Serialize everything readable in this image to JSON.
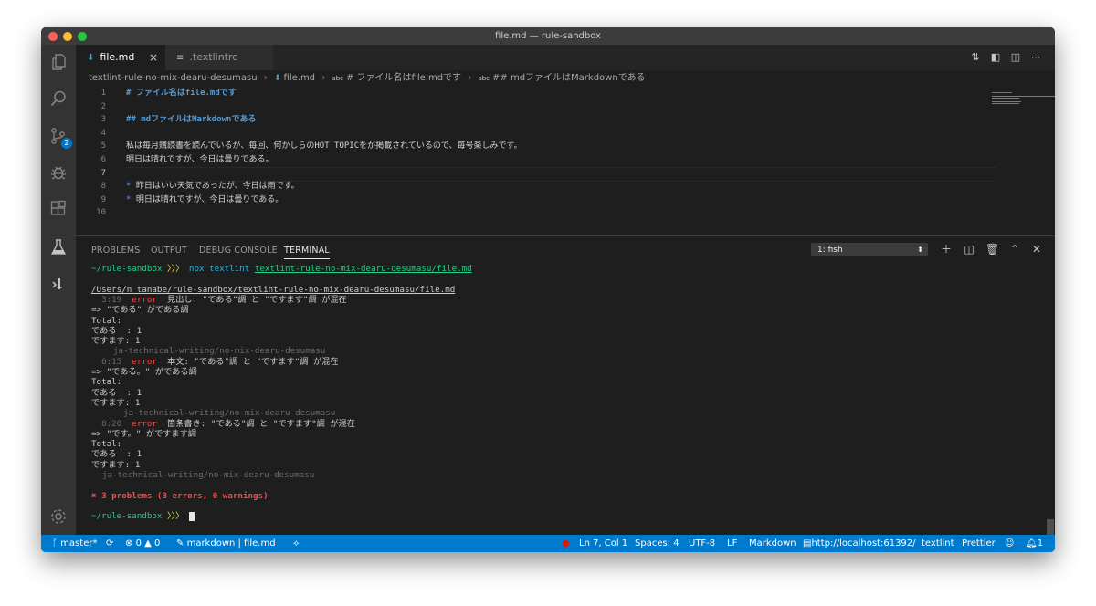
{
  "window": {
    "title": "file.md — rule-sandbox",
    "traffic_lights": [
      "#ff5f57",
      "#febc2e",
      "#28c840"
    ]
  },
  "activity_bar": {
    "items": [
      "explorer-icon",
      "search-icon",
      "source-control-icon",
      "debug-icon",
      "extensions-icon",
      "test-flask-icon",
      "remote-icon"
    ],
    "scm_badge": "2",
    "bottom": "settings-gear-icon"
  },
  "tabs": [
    {
      "label": "file.md",
      "icon": "markdown-icon",
      "active": true,
      "close": "×"
    },
    {
      "label": ".textlintrc",
      "icon": "settings-file-icon",
      "active": false
    }
  ],
  "editor_actions": [
    "open-changes-icon",
    "open-preview-icon",
    "split-editor-icon",
    "more-actions-icon"
  ],
  "breadcrumb": {
    "folder": "textlint-rule-no-mix-dearu-desumasu",
    "file": "file.md",
    "heading1": "# ファイル名はfile.mdです",
    "heading2": "## mdファイルはMarkdownである"
  },
  "editor": {
    "cursor_line": 7,
    "lines": [
      {
        "n": "1",
        "text": "# ファイル名はfile.mdです",
        "kind": "heading"
      },
      {
        "n": "2",
        "text": "",
        "kind": "text"
      },
      {
        "n": "3",
        "text": "## mdファイルはMarkdownである",
        "kind": "heading"
      },
      {
        "n": "4",
        "text": "",
        "kind": "text"
      },
      {
        "n": "5",
        "text": "私は毎月購読書を読んでいるが、毎回、何かしらのHOT TOPICをが掲載されているので、毎号楽しみです。",
        "kind": "text"
      },
      {
        "n": "6",
        "text": "明日は晴れですが、今日は曇りである。",
        "kind": "text"
      },
      {
        "n": "7",
        "text": "",
        "kind": "text"
      },
      {
        "n": "8",
        "bullet": "*",
        "text": "昨日はいい天気であったが、今日は雨です。",
        "kind": "list"
      },
      {
        "n": "9",
        "bullet": "*",
        "text": "明日は晴れですが、今日は曇りである。",
        "kind": "list"
      },
      {
        "n": "10",
        "text": "",
        "kind": "text"
      }
    ]
  },
  "panel": {
    "tabs": [
      "PROBLEMS",
      "OUTPUT",
      "DEBUG CONSOLE",
      "TERMINAL"
    ],
    "active_tab": "TERMINAL",
    "terminal_select": "1: fish",
    "buttons": [
      "new-terminal-icon",
      "split-terminal-icon",
      "kill-terminal-icon",
      "maximize-panel-icon",
      "close-panel-icon"
    ]
  },
  "terminal": {
    "prompt_path": "~/rule-sandbox",
    "prompt_arrows": "〉〉〉",
    "cmd": "npx textlint",
    "cmd_arg": "textlint-rule-no-mix-dearu-desumasu/file.md",
    "file_path": "/Users/n_tanabe/rule-sandbox/textlint-rule-no-mix-dearu-desumasu/file.md",
    "errors": [
      {
        "pos": "3:19",
        "level": "error",
        "msg": "見出し: \"である\"調 と \"ですます\"調 が混在",
        "detail": "=> \"である\" がである調",
        "rule": "ja-technical-writing/no-mix-dearu-desumasu",
        "rule_indent": "    "
      },
      {
        "pos": "6:15",
        "level": "error",
        "msg": "本文: \"である\"調 と \"ですます\"調 が混在",
        "detail": "=> \"である。\" がである調",
        "rule": "ja-technical-writing/no-mix-dearu-desumasu",
        "rule_indent": "      "
      },
      {
        "pos": "8:20",
        "level": "error",
        "msg": "箇条書き: \"である\"調 と \"ですます\"調 が混在",
        "detail": "=> \"です。\" がですます調",
        "rule": "ja-technical-writing/no-mix-dearu-desumasu",
        "rule_indent": "  "
      }
    ],
    "total_label": "Total:",
    "total_dearu": "である  : 1",
    "total_desumasu": "ですます: 1",
    "summary": "✖ 3 problems (3 errors, 0 warnings)"
  },
  "status": {
    "branch": "master*",
    "sync": "sync-icon",
    "errors": "0",
    "warnings": "0",
    "left_extra": "markdown | file.md",
    "broadcast": "live-share-icon",
    "position": "Ln 7, Col 1",
    "spaces": "Spaces: 4",
    "encoding": "UTF-8",
    "eol": "LF",
    "language": "Markdown",
    "server": "http://localhost:61392/",
    "linter": "textlint",
    "formatter": "Prettier",
    "feedback": "smiley-icon",
    "notifications": "1"
  }
}
